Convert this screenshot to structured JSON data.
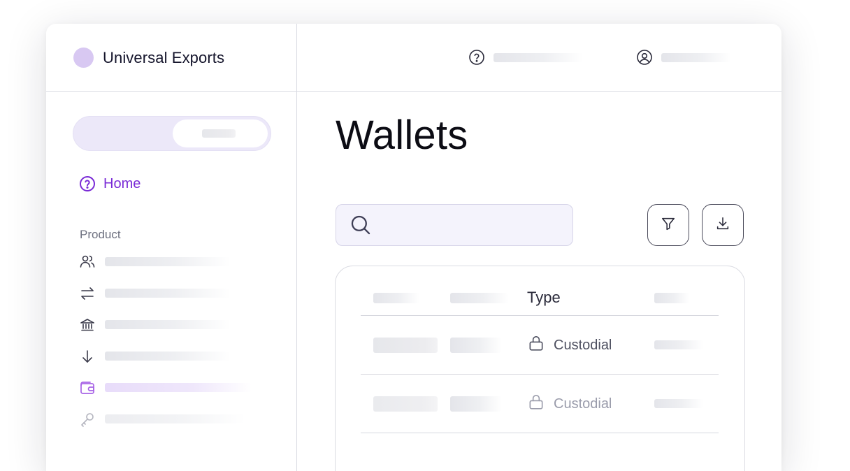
{
  "brand": {
    "name": "Universal Exports",
    "dot_color": "#d8c8f2"
  },
  "topbar": {
    "items": [
      {
        "icon": "help-circle-icon"
      },
      {
        "icon": "user-circle-icon"
      }
    ]
  },
  "sidebar": {
    "home_label": "Home",
    "home_icon": "help-circle-icon",
    "section_label": "Product",
    "items": [
      {
        "icon": "users-icon"
      },
      {
        "icon": "arrows-swap-icon"
      },
      {
        "icon": "bank-icon"
      },
      {
        "icon": "arrow-down-icon"
      },
      {
        "icon": "wallet-icon",
        "active": true
      },
      {
        "icon": "key-icon"
      }
    ],
    "accent_color": "#7a2bd6"
  },
  "main": {
    "title": "Wallets",
    "search": {
      "placeholder": ""
    },
    "actions": [
      {
        "icon": "filter-icon"
      },
      {
        "icon": "download-icon"
      }
    ],
    "table": {
      "type_header": "Type",
      "rows": [
        {
          "type": "Custodial",
          "icon": "lock-icon"
        },
        {
          "type": "Custodial",
          "icon": "lock-icon"
        }
      ]
    }
  }
}
